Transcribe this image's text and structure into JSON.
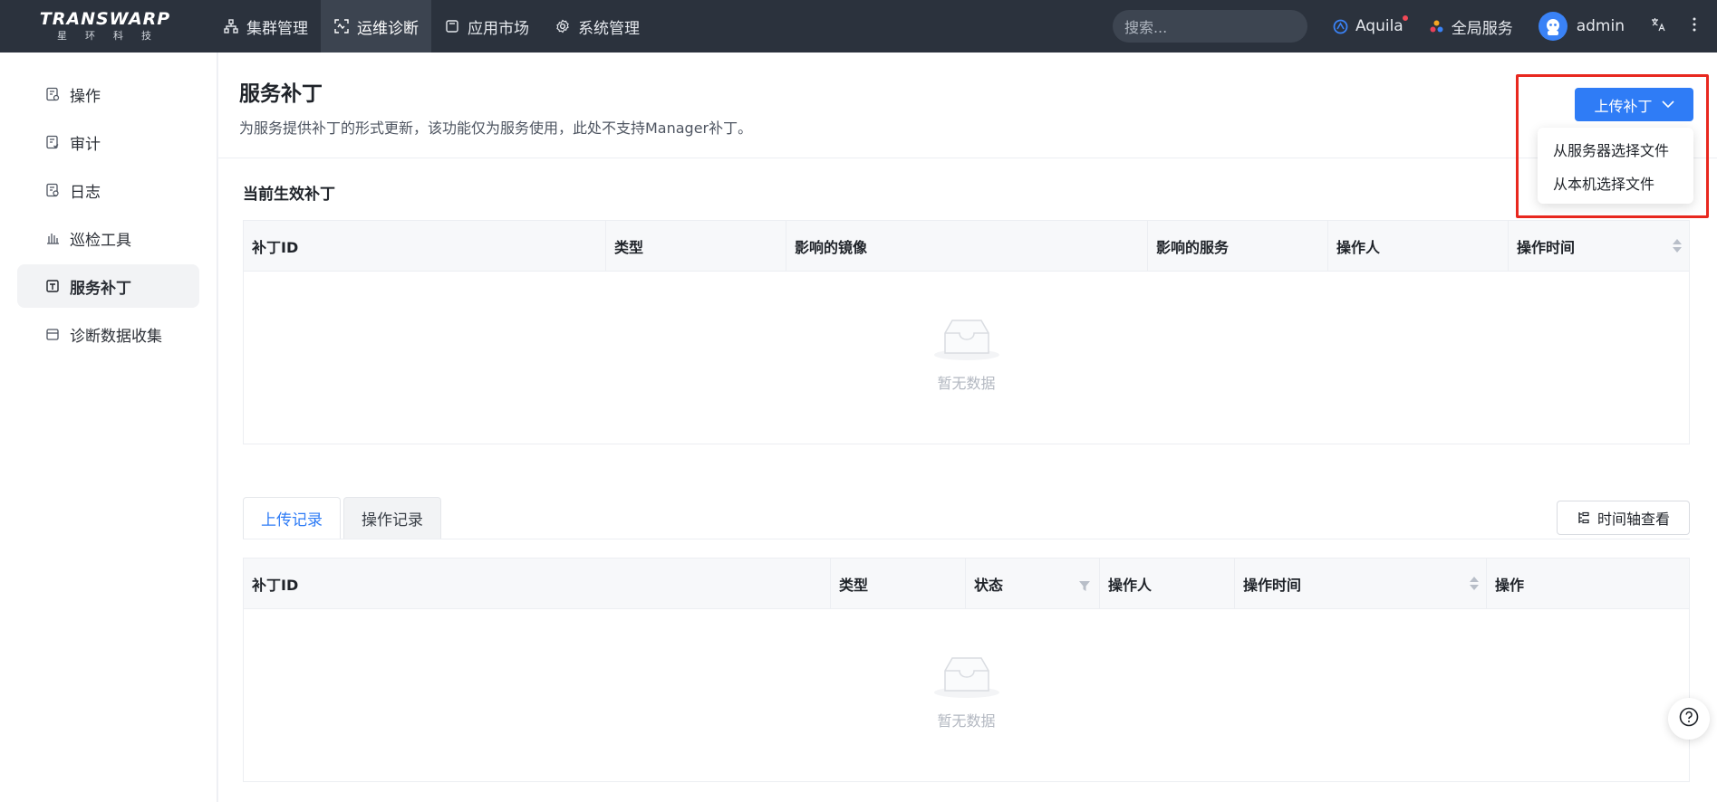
{
  "logo": {
    "word": "TRANSWARP",
    "sub": "星环科技"
  },
  "nav": {
    "items": [
      {
        "label": "集群管理",
        "icon": "cluster-icon"
      },
      {
        "label": "运维诊断",
        "icon": "diagnosis-icon",
        "active": true
      },
      {
        "label": "应用市场",
        "icon": "market-icon"
      },
      {
        "label": "系统管理",
        "icon": "gear-icon"
      }
    ],
    "search_placeholder": "搜索...",
    "aquila": "Aquila",
    "global_services": "全局服务",
    "user": "admin"
  },
  "sidebar": {
    "items": [
      {
        "label": "操作",
        "icon": "operation-icon"
      },
      {
        "label": "审计",
        "icon": "audit-icon"
      },
      {
        "label": "日志",
        "icon": "log-icon"
      },
      {
        "label": "巡检工具",
        "icon": "inspection-icon"
      },
      {
        "label": "服务补丁",
        "icon": "patch-icon",
        "active": true
      },
      {
        "label": "诊断数据收集",
        "icon": "data-collect-icon"
      }
    ]
  },
  "page": {
    "title": "服务补丁",
    "description": "为服务提供补丁的形式更新，该功能仅为服务使用，此处不支持Manager补丁。"
  },
  "upload": {
    "button_label": "上传补丁",
    "menu": [
      "从服务器选择文件",
      "从本机选择文件"
    ]
  },
  "current": {
    "title": "当前生效补丁",
    "columns": [
      "补丁ID",
      "类型",
      "影响的镜像",
      "影响的服务",
      "操作人",
      "操作时间"
    ],
    "empty_text": "暂无数据"
  },
  "tabs": [
    "上传记录",
    "操作记录"
  ],
  "timeline_label": "时间轴查看",
  "records": {
    "columns": [
      "补丁ID",
      "类型",
      "状态",
      "操作人",
      "操作时间",
      "操作"
    ],
    "empty_text": "暂无数据"
  },
  "colors": {
    "primary": "#2f7cf6",
    "topbar": "#2b323d",
    "highlight": "#e8281f"
  }
}
